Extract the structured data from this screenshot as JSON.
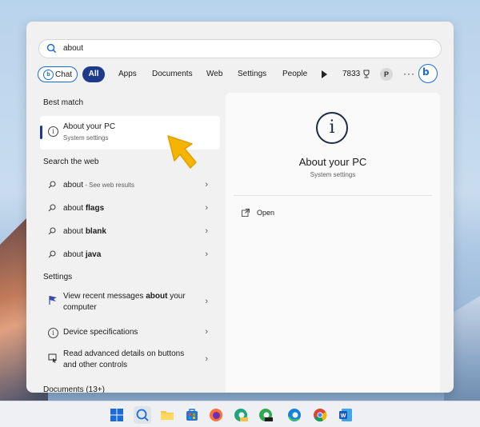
{
  "search": {
    "query": "about"
  },
  "filters": {
    "chat": "Chat",
    "all": "All",
    "apps": "Apps",
    "documents": "Documents",
    "web": "Web",
    "settings": "Settings",
    "people": "People",
    "points": "7833",
    "avatar_letter": "P",
    "more": "···",
    "bing_letter": "b"
  },
  "best_match": {
    "heading": "Best match",
    "title": "About your PC",
    "subtitle": "System settings"
  },
  "web": {
    "heading": "Search the web",
    "items": [
      {
        "prefix": "about",
        "bold": "",
        "hint": " - See web results"
      },
      {
        "prefix": "about ",
        "bold": "flags",
        "hint": ""
      },
      {
        "prefix": "about ",
        "bold": "blank",
        "hint": ""
      },
      {
        "prefix": "about ",
        "bold": "java",
        "hint": ""
      }
    ]
  },
  "settings": {
    "heading": "Settings",
    "items": [
      {
        "pre": "View recent messages ",
        "bold": "about",
        "post": " your computer"
      },
      {
        "pre": "Device specifications",
        "bold": "",
        "post": ""
      },
      {
        "pre": "Read advanced details on buttons and other controls",
        "bold": "",
        "post": ""
      }
    ]
  },
  "documents": {
    "heading": "Documents (13+)"
  },
  "detail": {
    "title": "About your PC",
    "subtitle": "System settings",
    "open": "Open"
  },
  "colors": {
    "accent": "#1e3a8a",
    "bing_blue": "#1a6bd6",
    "cursor": "#f5b400"
  }
}
